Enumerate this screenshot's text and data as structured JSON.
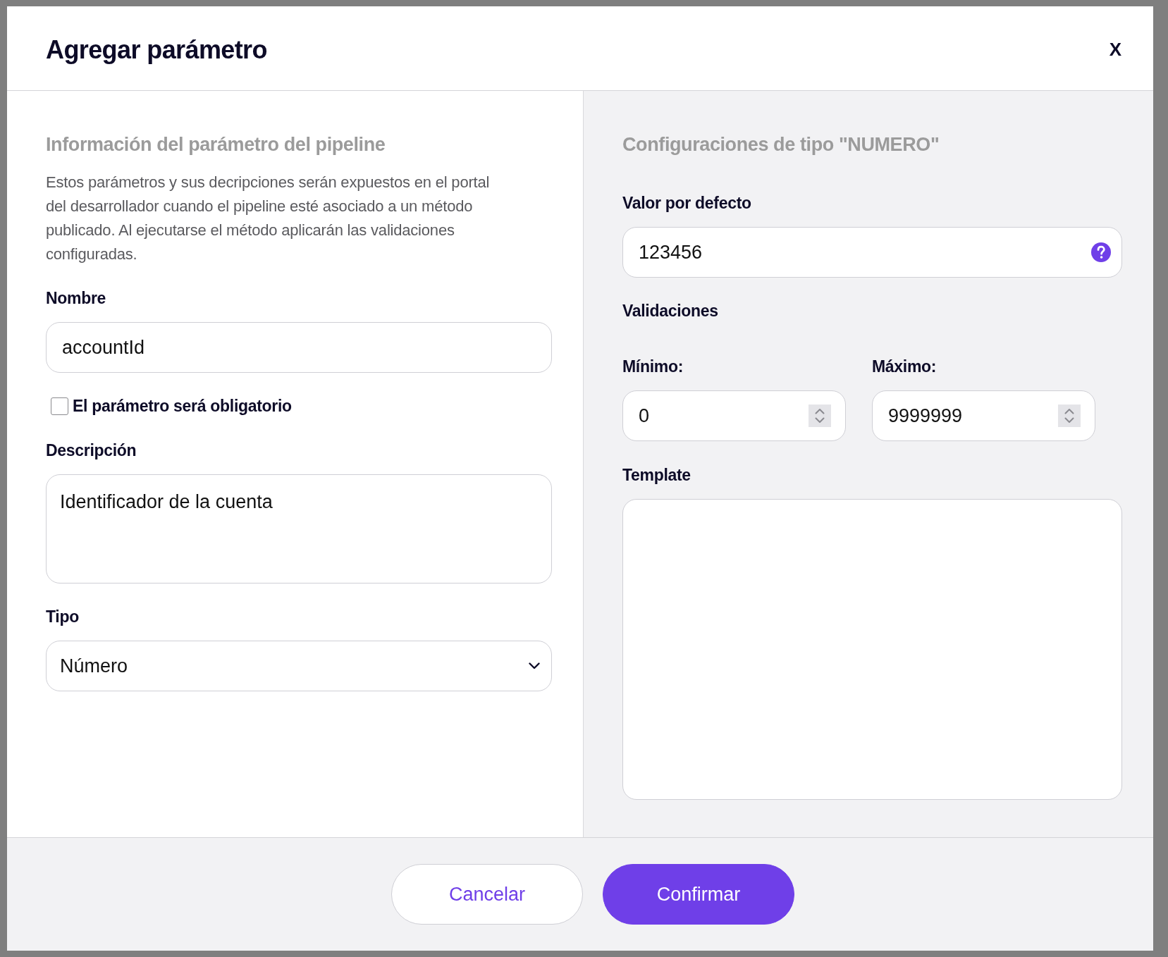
{
  "dialog": {
    "title": "Agregar parámetro",
    "close": "X"
  },
  "left_panel": {
    "heading": "Información del parámetro del pipeline",
    "intro": "Estos parámetros y sus decripciones serán expuestos en el portal del desarrollador cuando el pipeline esté asociado a un método publicado. Al ejecutarse el método aplicarán las validaciones configuradas.",
    "name_field": {
      "label": "Nombre",
      "value": "accountId"
    },
    "required_checkbox": {
      "label": "El parámetro será obligatorio",
      "checked": false
    },
    "description_field": {
      "label": "Descripción",
      "value": "Identificador de la cuenta"
    },
    "type_field": {
      "label": "Tipo",
      "value": "Número"
    }
  },
  "right_panel": {
    "heading": "Configuraciones de tipo \"NUMERO\"",
    "default_value_field": {
      "label": "Valor por defecto",
      "value": "123456"
    },
    "validations": {
      "title": "Validaciones",
      "fields": [
        {
          "label": "Mínimo:",
          "value": "0"
        },
        {
          "label": "Máximo:",
          "value": "9999999"
        }
      ]
    },
    "template_field": {
      "label": "Template"
    }
  },
  "footer": {
    "buttons": [
      {
        "label": "Cancelar",
        "kind": "secondary"
      },
      {
        "label": "Confirmar",
        "kind": "primary"
      }
    ]
  }
}
